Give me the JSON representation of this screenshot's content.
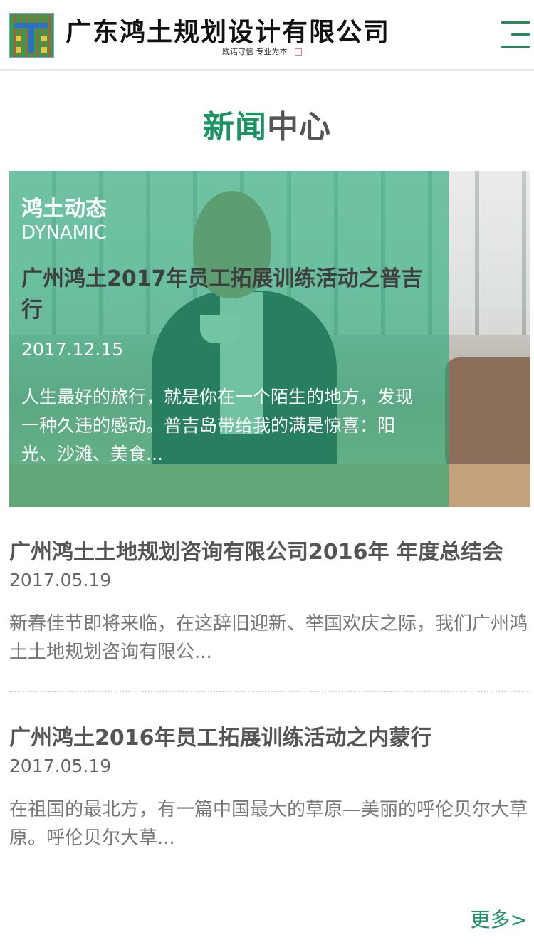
{
  "header": {
    "company_name": "广东鸿土规划设计有限公司",
    "slogan": "践诺守信 专业为本",
    "menu_icon": "hamburger-menu-icon",
    "logo_icon": "company-logo-icon"
  },
  "section": {
    "title_highlight": "新闻",
    "title_rest": "中心"
  },
  "feature": {
    "category": "鸿土动态",
    "category_en": "DYNAMIC",
    "title": "广州鸿土2017年员工拓展训练活动之普吉行",
    "date": "2017.12.15",
    "summary": "人生最好的旅行，就是你在一个陌生的地方，发现一种久违的感动。普吉岛带给我的满是惊喜：阳光、沙滩、美食..."
  },
  "news": [
    {
      "title": "广州鸿土土地规划咨询有限公司2016年 年度总结会",
      "date": "2017.05.19",
      "summary": "新春佳节即将来临，在这辞旧迎新、举国欢庆之际，我们广州鸿土土地规划咨询有限公..."
    },
    {
      "title": "广州鸿土2016年员工拓展训练活动之内蒙行",
      "date": "2017.05.19",
      "summary": "在祖国的最北方，有一篇中国最大的草原—美丽的呼伦贝尔大草原。呼伦贝尔大草..."
    }
  ],
  "more_label": "更多>",
  "colors": {
    "accent": "#1a9463",
    "overlay": "#24aa76",
    "title_gray": "#555555"
  }
}
